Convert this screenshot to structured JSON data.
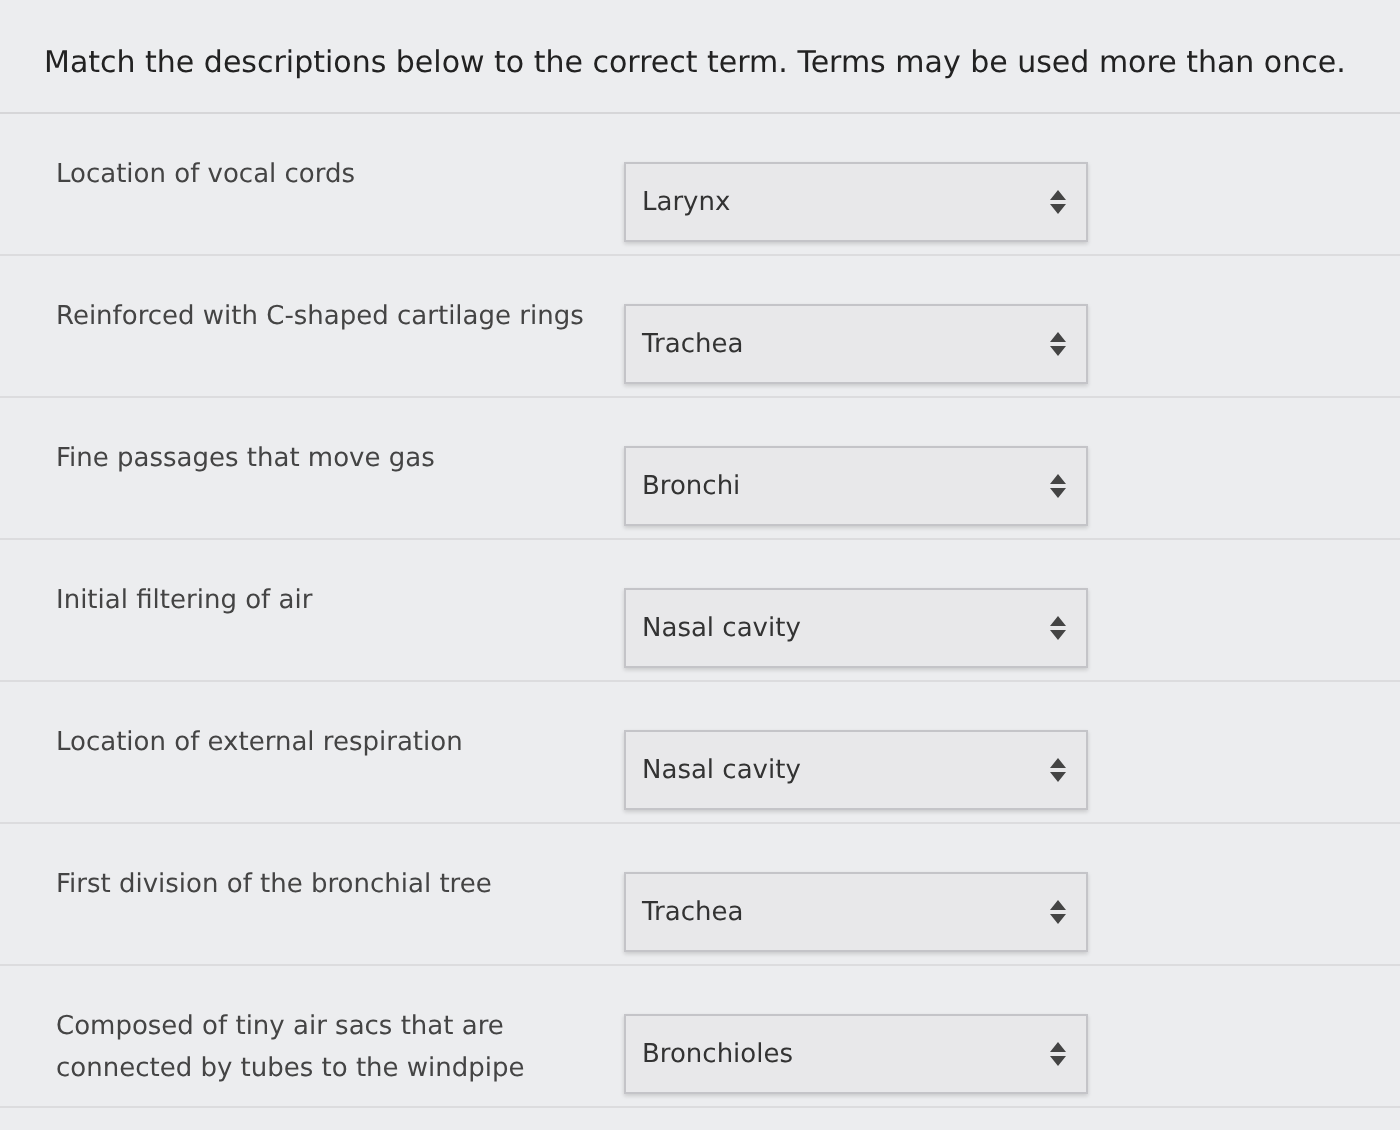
{
  "instructions": "Match the descriptions below to the correct term. Terms may be used more than once.",
  "items": [
    {
      "description": "Location of vocal cords",
      "answer": "Larynx"
    },
    {
      "description": "Reinforced with C-shaped cartilage rings",
      "answer": "Trachea"
    },
    {
      "description": "Fine passages that move gas",
      "answer": "Bronchi"
    },
    {
      "description": "Initial filtering of air",
      "answer": "Nasal cavity"
    },
    {
      "description": "Location of external respiration",
      "answer": "Nasal cavity"
    },
    {
      "description": "First division of the bronchial tree",
      "answer": "Trachea"
    },
    {
      "description": "Composed of tiny air sacs that are connected by tubes to the windpipe",
      "answer": "Bronchioles"
    }
  ]
}
